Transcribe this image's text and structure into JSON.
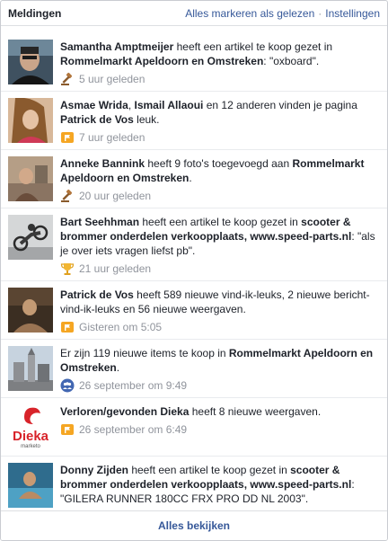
{
  "header": {
    "title": "Meldingen",
    "mark_all_read": "Alles markeren als gelezen",
    "separator": "·",
    "settings": "Instellingen"
  },
  "notifications": [
    {
      "parts": [
        "Samantha Amptmeijer",
        " heeft een artikel te koop gezet in ",
        "Rommelmarkt Apeldoorn en Omstreken",
        ": \"oxboard\"."
      ],
      "time": "5 uur geleden",
      "icon": "gavel-icon"
    },
    {
      "parts": [
        "Asmae Wrida",
        ", ",
        "Ismail Allaoui",
        " en 12 anderen vinden je pagina ",
        "Patrick de Vos",
        " leuk."
      ],
      "time": "7 uur geleden",
      "icon": "flag-icon"
    },
    {
      "parts": [
        "Anneke Bannink",
        " heeft 9 foto's toegevoegd aan ",
        "Rommelmarkt Apeldoorn en Omstreken",
        "."
      ],
      "time": "20 uur geleden",
      "icon": "gavel-icon"
    },
    {
      "parts": [
        "Bart Seehhman",
        " heeft een artikel te koop gezet in ",
        "scooter & brommer onderdelen verkoopplaats, www.speed-parts.nl",
        ": \"als je over iets vragen liefst pb\"."
      ],
      "time": "21 uur geleden",
      "icon": "trophy-icon"
    },
    {
      "parts": [
        "Patrick de Vos",
        " heeft 589 nieuwe vind-ik-leuks, 2 nieuwe bericht-vind-ik-leuks en 56 nieuwe weergaven."
      ],
      "time": "Gisteren om 5:05",
      "icon": "flag-icon"
    },
    {
      "parts": [
        "Er zijn 119 nieuwe items te koop in ",
        "Rommelmarkt Apeldoorn en Omstreken",
        "."
      ],
      "time": "26 september om 9:49",
      "icon": "group-icon"
    },
    {
      "parts": [
        "Verloren/gevonden Dieka",
        " heeft 8 nieuwe weergaven."
      ],
      "time": "26 september om 6:49",
      "icon": "flag-icon"
    },
    {
      "parts": [
        "Donny Zijden",
        " heeft een artikel te koop gezet in ",
        "scooter & brommer onderdelen verkoopplaats, www.speed-parts.nl",
        ": \"GILERA RUNNER 180CC FRX PRO DD NL 2003\"."
      ],
      "time": "",
      "icon": ""
    }
  ],
  "logo": {
    "brand": "Dieka",
    "sub": "marketo"
  },
  "footer": {
    "label": "Alles bekijken"
  },
  "colors": {
    "link": "#365899",
    "meta": "#90949c",
    "border": "#dddfe2",
    "logo_red": "#d8232a",
    "flag_orange": "#f5a623",
    "group_blue": "#4267b2"
  }
}
